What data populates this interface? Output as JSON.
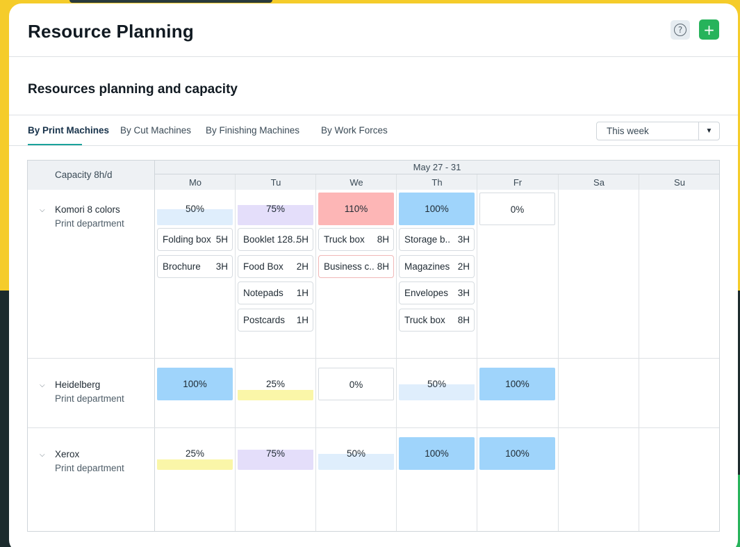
{
  "header": {
    "title": "Resource Planning",
    "help_icon": "question-circle-icon",
    "add_icon": "plus-icon",
    "add_label": "+",
    "help_label": "?"
  },
  "section": {
    "title": "Resources planning and capacity"
  },
  "tabs": [
    {
      "label": "By Print Machines",
      "active": true
    },
    {
      "label": "By Cut Machines",
      "active": false
    },
    {
      "label": "By Finishing Machines",
      "active": false
    },
    {
      "label": "By Work Forces",
      "active": false
    }
  ],
  "period_select": {
    "value": "This week",
    "icon": "caret-down-icon"
  },
  "grid": {
    "capacity_label": "Capacity 8h/d",
    "range_label": "May 27 - 31",
    "days": [
      "Mo",
      "Tu",
      "We",
      "Th",
      "Fr",
      "Sa",
      "Su"
    ],
    "machines": [
      {
        "name": "Komori 8 colors",
        "department": "Print department",
        "load": [
          {
            "label": "50%",
            "value": 50,
            "color": "#dfeefc"
          },
          {
            "label": "75%",
            "value": 75,
            "color": "#e4defa"
          },
          {
            "label": "110%",
            "value": 110,
            "color": "#fdb6b6"
          },
          {
            "label": "100%",
            "value": 100,
            "color": "#9fd4fb"
          },
          {
            "label": "0%",
            "value": 0,
            "color": "#ffffff"
          }
        ],
        "tasks": [
          [
            {
              "name": "Folding box",
              "hours": "5H"
            },
            {
              "name": "Brochure",
              "hours": "3H"
            }
          ],
          [
            {
              "name": "Booklet 128..",
              "hours": "5H"
            },
            {
              "name": "Food Box",
              "hours": "2H"
            },
            {
              "name": "Notepads",
              "hours": "1H"
            },
            {
              "name": "Postcards",
              "hours": "1H"
            }
          ],
          [
            {
              "name": "Truck box",
              "hours": "8H"
            },
            {
              "name": "Business c..",
              "hours": "8H"
            }
          ],
          [
            {
              "name": "Storage b..",
              "hours": "3H"
            },
            {
              "name": "Magazines",
              "hours": "2H"
            },
            {
              "name": "Envelopes",
              "hours": "3H"
            },
            {
              "name": "Truck box",
              "hours": "8H"
            }
          ]
        ]
      },
      {
        "name": "Heidelberg",
        "department": "Print department",
        "load": [
          {
            "label": "100%",
            "value": 100,
            "color": "#9fd4fb"
          },
          {
            "label": "25%",
            "value": 25,
            "color": "#faf6a8"
          },
          {
            "label": "0%",
            "value": 0,
            "color": "#ffffff"
          },
          {
            "label": "50%",
            "value": 50,
            "color": "#dfeefc"
          },
          {
            "label": "100%",
            "value": 100,
            "color": "#9fd4fb"
          }
        ]
      },
      {
        "name": "Xerox",
        "department": "Print department",
        "load": [
          {
            "label": "25%",
            "value": 25,
            "color": "#faf6a8"
          },
          {
            "label": "75%",
            "value": 75,
            "color": "#e4defa"
          },
          {
            "label": "50%",
            "value": 50,
            "color": "#dfeefc"
          },
          {
            "label": "100%",
            "value": 100,
            "color": "#9fd4fb"
          },
          {
            "label": "100%",
            "value": 100,
            "color": "#9fd4fb"
          }
        ]
      }
    ]
  }
}
